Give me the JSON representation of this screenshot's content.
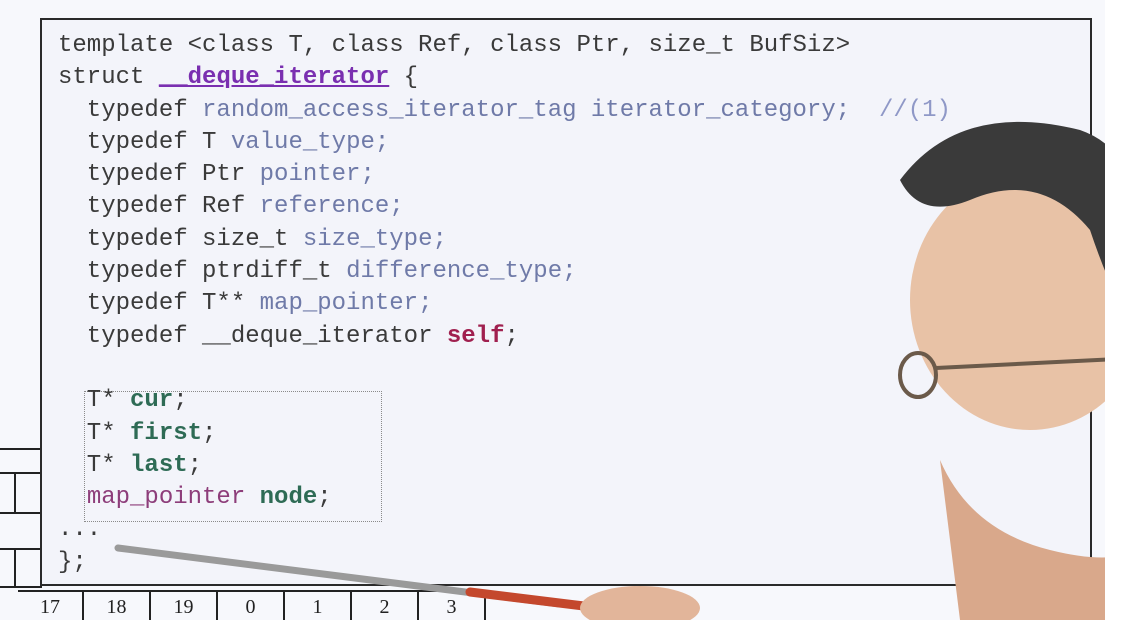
{
  "code": {
    "line1": {
      "t1": "template <class T, class Ref, class Ptr, size",
      "t2": "_",
      "t3": "t BufSiz>"
    },
    "line2": {
      "t1": "struct ",
      "name": "__deque_iterator",
      "t2": " {"
    },
    "line3": {
      "kw": "  typedef ",
      "t1": "random_access_iterator_tag iterator_category;",
      "comment": "  //(1)"
    },
    "line4": {
      "kw": "  typedef ",
      "t1": "T ",
      "t2": "value_type;"
    },
    "line5": {
      "kw": "  typedef ",
      "t1": "Ptr ",
      "t2": "pointer;"
    },
    "line6": {
      "kw": "  typedef ",
      "t1": "Ref ",
      "t2": "reference;"
    },
    "line7": {
      "kw": "  typedef ",
      "t1": "size_t ",
      "t2": "size_type;"
    },
    "line8": {
      "kw": "  typedef ",
      "t1": "ptrdiff_t ",
      "t2": "difference_type;"
    },
    "line9": {
      "kw": "  typedef ",
      "t1": "T** ",
      "t2": "map_pointer;"
    },
    "line10": {
      "kw": "  typedef ",
      "t1": "__deque_iterator ",
      "self": "self",
      "t2": ";"
    },
    "line11": "",
    "line12": {
      "t1": "  T* ",
      "f": "cur",
      "t2": ";"
    },
    "line13": {
      "t1": "  T* ",
      "f": "first",
      "t2": ";"
    },
    "line14": {
      "t1": "  T* ",
      "f": "last",
      "t2": ";"
    },
    "line15": {
      "t1": "  ",
      "mp": "map_pointer",
      "t2": " ",
      "f": "node",
      "t3": ";"
    },
    "line16": "...",
    "line17": "};"
  },
  "index_strip": [
    "17",
    "18",
    "19",
    "0",
    "1",
    "2",
    "3"
  ],
  "colors": {
    "panel_bg": "#f3f4fa",
    "struct_name": "#7a2fb0",
    "self_keyword": "#a0204f",
    "field_names": "#2e6b55",
    "type_names": "#6f7aa8"
  }
}
